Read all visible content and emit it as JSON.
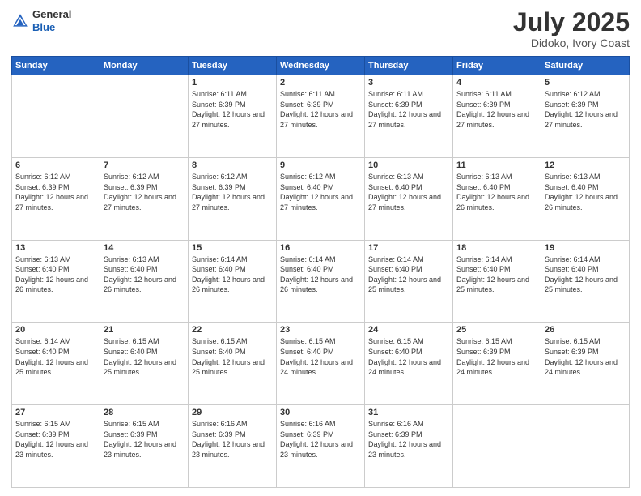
{
  "logo": {
    "line1": "General",
    "line2": "Blue"
  },
  "title": {
    "month": "July 2025",
    "location": "Didoko, Ivory Coast"
  },
  "weekdays": [
    "Sunday",
    "Monday",
    "Tuesday",
    "Wednesday",
    "Thursday",
    "Friday",
    "Saturday"
  ],
  "weeks": [
    [
      {
        "day": "",
        "info": ""
      },
      {
        "day": "",
        "info": ""
      },
      {
        "day": "1",
        "info": "Sunrise: 6:11 AM\nSunset: 6:39 PM\nDaylight: 12 hours and 27 minutes."
      },
      {
        "day": "2",
        "info": "Sunrise: 6:11 AM\nSunset: 6:39 PM\nDaylight: 12 hours and 27 minutes."
      },
      {
        "day": "3",
        "info": "Sunrise: 6:11 AM\nSunset: 6:39 PM\nDaylight: 12 hours and 27 minutes."
      },
      {
        "day": "4",
        "info": "Sunrise: 6:11 AM\nSunset: 6:39 PM\nDaylight: 12 hours and 27 minutes."
      },
      {
        "day": "5",
        "info": "Sunrise: 6:12 AM\nSunset: 6:39 PM\nDaylight: 12 hours and 27 minutes."
      }
    ],
    [
      {
        "day": "6",
        "info": "Sunrise: 6:12 AM\nSunset: 6:39 PM\nDaylight: 12 hours and 27 minutes."
      },
      {
        "day": "7",
        "info": "Sunrise: 6:12 AM\nSunset: 6:39 PM\nDaylight: 12 hours and 27 minutes."
      },
      {
        "day": "8",
        "info": "Sunrise: 6:12 AM\nSunset: 6:39 PM\nDaylight: 12 hours and 27 minutes."
      },
      {
        "day": "9",
        "info": "Sunrise: 6:12 AM\nSunset: 6:40 PM\nDaylight: 12 hours and 27 minutes."
      },
      {
        "day": "10",
        "info": "Sunrise: 6:13 AM\nSunset: 6:40 PM\nDaylight: 12 hours and 27 minutes."
      },
      {
        "day": "11",
        "info": "Sunrise: 6:13 AM\nSunset: 6:40 PM\nDaylight: 12 hours and 26 minutes."
      },
      {
        "day": "12",
        "info": "Sunrise: 6:13 AM\nSunset: 6:40 PM\nDaylight: 12 hours and 26 minutes."
      }
    ],
    [
      {
        "day": "13",
        "info": "Sunrise: 6:13 AM\nSunset: 6:40 PM\nDaylight: 12 hours and 26 minutes."
      },
      {
        "day": "14",
        "info": "Sunrise: 6:13 AM\nSunset: 6:40 PM\nDaylight: 12 hours and 26 minutes."
      },
      {
        "day": "15",
        "info": "Sunrise: 6:14 AM\nSunset: 6:40 PM\nDaylight: 12 hours and 26 minutes."
      },
      {
        "day": "16",
        "info": "Sunrise: 6:14 AM\nSunset: 6:40 PM\nDaylight: 12 hours and 26 minutes."
      },
      {
        "day": "17",
        "info": "Sunrise: 6:14 AM\nSunset: 6:40 PM\nDaylight: 12 hours and 25 minutes."
      },
      {
        "day": "18",
        "info": "Sunrise: 6:14 AM\nSunset: 6:40 PM\nDaylight: 12 hours and 25 minutes."
      },
      {
        "day": "19",
        "info": "Sunrise: 6:14 AM\nSunset: 6:40 PM\nDaylight: 12 hours and 25 minutes."
      }
    ],
    [
      {
        "day": "20",
        "info": "Sunrise: 6:14 AM\nSunset: 6:40 PM\nDaylight: 12 hours and 25 minutes."
      },
      {
        "day": "21",
        "info": "Sunrise: 6:15 AM\nSunset: 6:40 PM\nDaylight: 12 hours and 25 minutes."
      },
      {
        "day": "22",
        "info": "Sunrise: 6:15 AM\nSunset: 6:40 PM\nDaylight: 12 hours and 25 minutes."
      },
      {
        "day": "23",
        "info": "Sunrise: 6:15 AM\nSunset: 6:40 PM\nDaylight: 12 hours and 24 minutes."
      },
      {
        "day": "24",
        "info": "Sunrise: 6:15 AM\nSunset: 6:40 PM\nDaylight: 12 hours and 24 minutes."
      },
      {
        "day": "25",
        "info": "Sunrise: 6:15 AM\nSunset: 6:39 PM\nDaylight: 12 hours and 24 minutes."
      },
      {
        "day": "26",
        "info": "Sunrise: 6:15 AM\nSunset: 6:39 PM\nDaylight: 12 hours and 24 minutes."
      }
    ],
    [
      {
        "day": "27",
        "info": "Sunrise: 6:15 AM\nSunset: 6:39 PM\nDaylight: 12 hours and 23 minutes."
      },
      {
        "day": "28",
        "info": "Sunrise: 6:15 AM\nSunset: 6:39 PM\nDaylight: 12 hours and 23 minutes."
      },
      {
        "day": "29",
        "info": "Sunrise: 6:16 AM\nSunset: 6:39 PM\nDaylight: 12 hours and 23 minutes."
      },
      {
        "day": "30",
        "info": "Sunrise: 6:16 AM\nSunset: 6:39 PM\nDaylight: 12 hours and 23 minutes."
      },
      {
        "day": "31",
        "info": "Sunrise: 6:16 AM\nSunset: 6:39 PM\nDaylight: 12 hours and 23 minutes."
      },
      {
        "day": "",
        "info": ""
      },
      {
        "day": "",
        "info": ""
      }
    ]
  ]
}
